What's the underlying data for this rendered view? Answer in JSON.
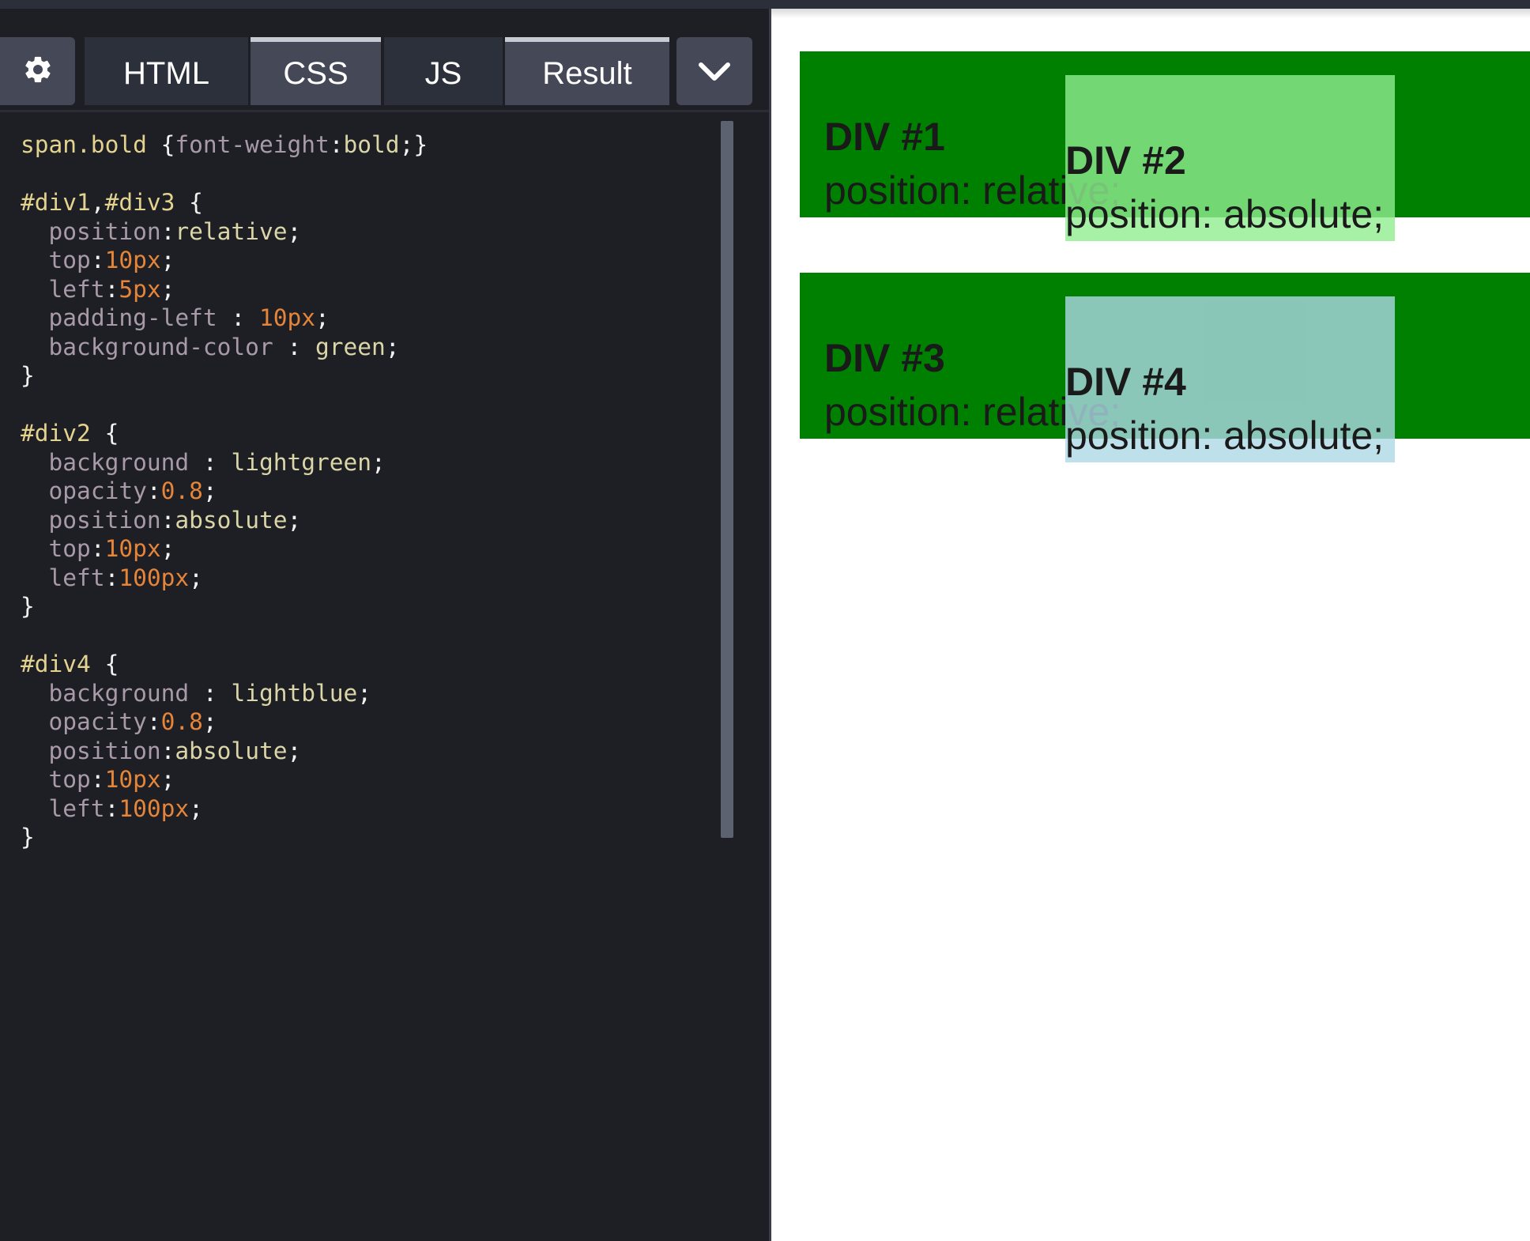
{
  "toolbar": {
    "settings_icon": "gear-icon",
    "tabs": [
      {
        "label": "HTML"
      },
      {
        "label": "CSS"
      },
      {
        "label": "JS"
      },
      {
        "label": "Result"
      }
    ],
    "menu_icon": "chevron-down-icon"
  },
  "code_lines": [
    [
      [
        "sel",
        "span.bold "
      ],
      [
        "pun",
        "{"
      ],
      [
        "prop",
        "font-weight"
      ],
      [
        "pun",
        ":"
      ],
      [
        "val",
        "bold"
      ],
      [
        "pun",
        ";}"
      ]
    ],
    [],
    [
      [
        "sel",
        "#div1"
      ],
      [
        "pun",
        ","
      ],
      [
        "sel",
        "#div3"
      ],
      [
        "pun",
        " {"
      ]
    ],
    [
      [
        "pun",
        "  "
      ],
      [
        "prop",
        "position"
      ],
      [
        "pun",
        ":"
      ],
      [
        "val",
        "relative"
      ],
      [
        "pun",
        ";"
      ]
    ],
    [
      [
        "pun",
        "  "
      ],
      [
        "prop",
        "top"
      ],
      [
        "pun",
        ":"
      ],
      [
        "num",
        "10px"
      ],
      [
        "pun",
        ";"
      ]
    ],
    [
      [
        "pun",
        "  "
      ],
      [
        "prop",
        "left"
      ],
      [
        "pun",
        ":"
      ],
      [
        "num",
        "5px"
      ],
      [
        "pun",
        ";"
      ]
    ],
    [
      [
        "pun",
        "  "
      ],
      [
        "prop",
        "padding-left"
      ],
      [
        "pun",
        " : "
      ],
      [
        "num",
        "10px"
      ],
      [
        "pun",
        ";"
      ]
    ],
    [
      [
        "pun",
        "  "
      ],
      [
        "prop",
        "background-color"
      ],
      [
        "pun",
        " : "
      ],
      [
        "val",
        "green"
      ],
      [
        "pun",
        ";"
      ]
    ],
    [
      [
        "pun",
        "}"
      ]
    ],
    [],
    [
      [
        "sel",
        "#div2"
      ],
      [
        "pun",
        " {"
      ]
    ],
    [
      [
        "pun",
        "  "
      ],
      [
        "prop",
        "background"
      ],
      [
        "pun",
        " : "
      ],
      [
        "val",
        "lightgreen"
      ],
      [
        "pun",
        ";"
      ]
    ],
    [
      [
        "pun",
        "  "
      ],
      [
        "prop",
        "opacity"
      ],
      [
        "pun",
        ":"
      ],
      [
        "num",
        "0.8"
      ],
      [
        "pun",
        ";"
      ]
    ],
    [
      [
        "pun",
        "  "
      ],
      [
        "prop",
        "position"
      ],
      [
        "pun",
        ":"
      ],
      [
        "val",
        "absolute"
      ],
      [
        "pun",
        ";"
      ]
    ],
    [
      [
        "pun",
        "  "
      ],
      [
        "prop",
        "top"
      ],
      [
        "pun",
        ":"
      ],
      [
        "num",
        "10px"
      ],
      [
        "pun",
        ";"
      ]
    ],
    [
      [
        "pun",
        "  "
      ],
      [
        "prop",
        "left"
      ],
      [
        "pun",
        ":"
      ],
      [
        "num",
        "100px"
      ],
      [
        "pun",
        ";"
      ]
    ],
    [
      [
        "pun",
        "}"
      ]
    ],
    [],
    [
      [
        "sel",
        "#div4"
      ],
      [
        "pun",
        " {"
      ]
    ],
    [
      [
        "pun",
        "  "
      ],
      [
        "prop",
        "background"
      ],
      [
        "pun",
        " : "
      ],
      [
        "val",
        "lightblue"
      ],
      [
        "pun",
        ";"
      ]
    ],
    [
      [
        "pun",
        "  "
      ],
      [
        "prop",
        "opacity"
      ],
      [
        "pun",
        ":"
      ],
      [
        "num",
        "0.8"
      ],
      [
        "pun",
        ";"
      ]
    ],
    [
      [
        "pun",
        "  "
      ],
      [
        "prop",
        "position"
      ],
      [
        "pun",
        ":"
      ],
      [
        "val",
        "absolute"
      ],
      [
        "pun",
        ";"
      ]
    ],
    [
      [
        "pun",
        "  "
      ],
      [
        "prop",
        "top"
      ],
      [
        "pun",
        ":"
      ],
      [
        "num",
        "10px"
      ],
      [
        "pun",
        ";"
      ]
    ],
    [
      [
        "pun",
        "  "
      ],
      [
        "prop",
        "left"
      ],
      [
        "pun",
        ":"
      ],
      [
        "num",
        "100px"
      ],
      [
        "pun",
        ";"
      ]
    ],
    [
      [
        "pun",
        "}"
      ]
    ]
  ],
  "result": {
    "div1": {
      "title": "DIV #1",
      "text": "position: relative;"
    },
    "div2": {
      "title": "DIV #2",
      "text": "position: absolute;"
    },
    "div3": {
      "title": "DIV #3",
      "text": "position: relative;"
    },
    "div4": {
      "title": "DIV #4",
      "text": "position: absolute;"
    }
  },
  "colors": {
    "editor_bg": "#1e1f24",
    "green_box": "#008000",
    "lightgreen_overlay": "rgba(144,238,144,0.8)",
    "lightblue_overlay": "rgba(173,216,230,0.8)"
  }
}
